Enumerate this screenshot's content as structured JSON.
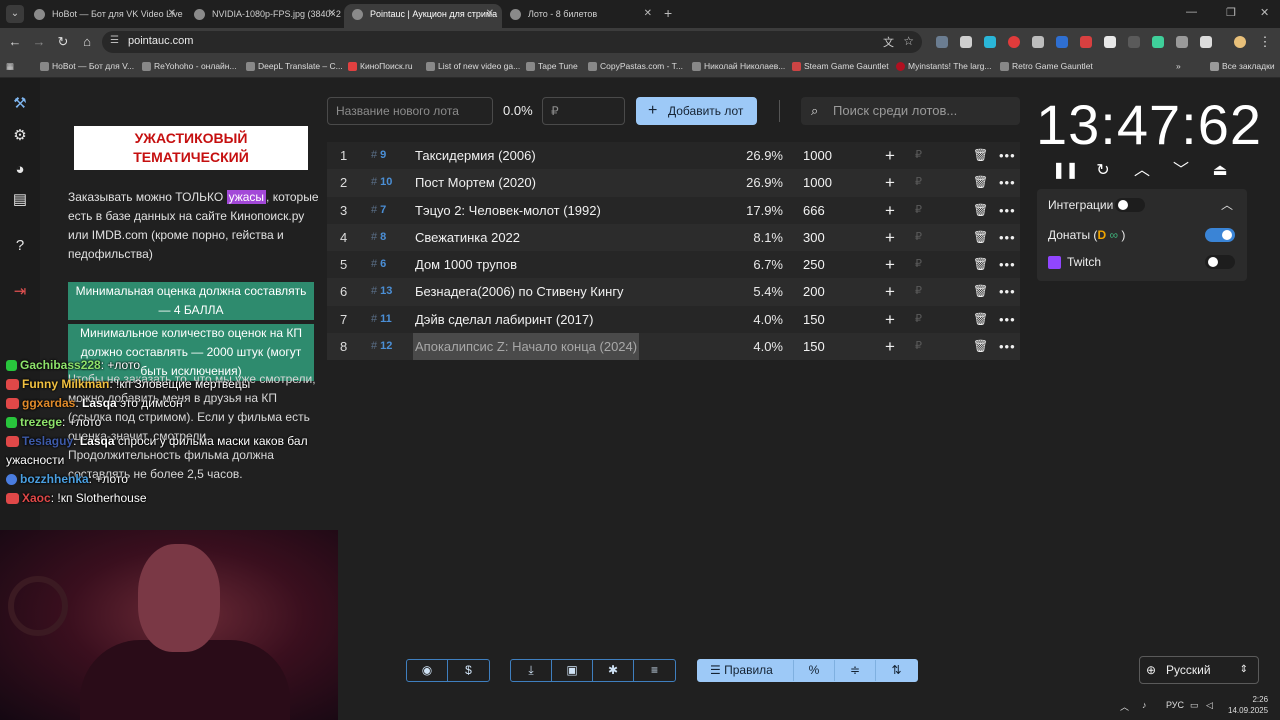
{
  "browser": {
    "tabs": [
      {
        "title": "HoBot — Бот для VK Video Live",
        "active": false
      },
      {
        "title": "NVIDIA-1080p-FPS.jpg (3840×2",
        "active": false
      },
      {
        "title": "Pointauc | Аукцион для стрима",
        "active": true
      },
      {
        "title": "Лото - 8 билетов",
        "active": false
      }
    ],
    "url": "pointauc.com",
    "bookmarks": [
      "HoBot — Бот для V...",
      "ReYohoho - онлайн...",
      "DeepL Translate – C...",
      "КиноПоиск.ru",
      "List of new video ga...",
      "Tape Tune",
      "CopyPastas.com - T...",
      "Николай Николаев...",
      "Steam Game Gauntlet",
      "Myinstants! The larg...",
      "Retro Game Gauntlet"
    ],
    "all_bookmarks": "Все закладки"
  },
  "rules": {
    "title": "УЖАСТИКОВЫЙ ТЕМАТИЧЕСКИЙ",
    "p1_a": "Заказывать можно ТОЛЬКО ",
    "p1_hl": "ужасы",
    "p1_b": ", которые есть в базе данных на сайте Кинопоиск.ру или IMDB.com (кроме порно, гейства и педофильства)",
    "green1": "Минимальная оценка должна составлять — 4 БАЛЛА",
    "green2": "Минимальное количество оценок на КП должно составлять — 2000 штук (могут быть исключения)",
    "under": "Чтобы не заказать то, что мы уже смотрели, можно добавить меня в друзья на КП (ссылка под стримом). Если у фильма есть оценка-значит, смотрели. Продолжительность фильма должна составлять не более 2,5 часов."
  },
  "chat": [
    {
      "user": "Gachibass228",
      "color": "#8ee36b",
      "badge": "k",
      "text": " +лото"
    },
    {
      "user": "Funny Milkman",
      "color": "#f0c040",
      "badge": "live",
      "text": " !кп Зловещие мертвецы"
    },
    {
      "user": "ggxardas",
      "color": "#e08a2a",
      "badge": "live",
      "mention": "Lasqa",
      "text": " это димсон"
    },
    {
      "user": "trezege",
      "color": "#8ee36b",
      "badge": "k",
      "text": " +лото"
    },
    {
      "user": "Teslaguy",
      "color": "#3d5aa8",
      "badge": "live",
      "mention": "Lasqa",
      "text": " спроси у фильма маски каков бал ужасности"
    },
    {
      "user": "bozzhhenka",
      "color": "#4a9fe0",
      "badge": "g",
      "text": " +лото"
    },
    {
      "user": "Xaoc",
      "color": "#e04848",
      "badge": "live",
      "text": " !кп Slotherhouse"
    }
  ],
  "controls": {
    "lot_name_placeholder": "Название нового лота",
    "percent": "0.0%",
    "currency_placeholder": "₽",
    "add_button": "Добавить лот",
    "search_placeholder": "Поиск среди лотов..."
  },
  "lots": [
    {
      "n": "1",
      "id": "9",
      "name": "Таксидермия (2006)",
      "pct": "26.9%",
      "amount": "1000"
    },
    {
      "n": "2",
      "id": "10",
      "name": "Пост Мортем (2020)",
      "pct": "26.9%",
      "amount": "1000"
    },
    {
      "n": "3",
      "id": "7",
      "name": "Тэцуо 2: Человек-молот (1992)",
      "pct": "17.9%",
      "amount": "666"
    },
    {
      "n": "4",
      "id": "8",
      "name": "Свежатинка 2022",
      "pct": "8.1%",
      "amount": "300"
    },
    {
      "n": "5",
      "id": "6",
      "name": "Дом 1000 трупов",
      "pct": "6.7%",
      "amount": "250"
    },
    {
      "n": "6",
      "id": "13",
      "name": "Безнадега(2006) по Стивену Кингу",
      "pct": "5.4%",
      "amount": "200"
    },
    {
      "n": "7",
      "id": "11",
      "name": "Дэйв сделал лабиринт (2017)",
      "pct": "4.0%",
      "amount": "150"
    },
    {
      "n": "8",
      "id": "12",
      "name": "Апокалипсис Z: Начало конца (2024)",
      "pct": "4.0%",
      "amount": "150",
      "selected": true
    }
  ],
  "lot_row_symbols": {
    "hash": "#",
    "plus": "+",
    "rub": "₽"
  },
  "timer": {
    "display": "13:47:62"
  },
  "integrations": {
    "title": "Интеграции",
    "donations_label": "Донаты (",
    "donations_close": " )",
    "donations_on": true,
    "twitch_label": "Twitch",
    "twitch_on": false
  },
  "bottom": {
    "rules_label": "Правила",
    "language": "Русский"
  },
  "tray": {
    "lang": "РУС",
    "time": "2:26",
    "date": "14.09.2025"
  },
  "colors": {
    "accent": "#9dc9f7",
    "id_blue": "#4b8fd6",
    "rules_title_red": "#c50f0f",
    "green_highlight": "#2e8b6e",
    "purple_highlight": "#a349d8"
  }
}
